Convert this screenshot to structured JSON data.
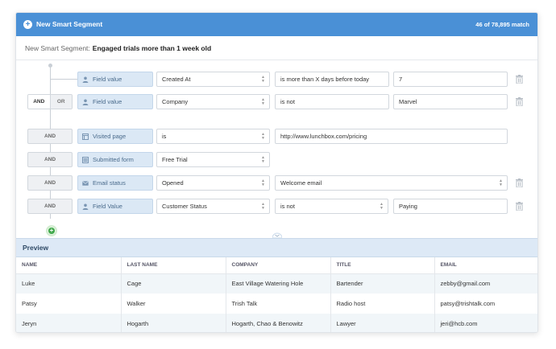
{
  "header": {
    "title": "New Smart Segment",
    "match_count": "46 of 78,895 match"
  },
  "segment": {
    "name_prefix": "New Smart Segment:",
    "name": "Engaged trials more than 1 week old"
  },
  "rules": [
    {
      "conjunction": "",
      "type_icon": "person-icon",
      "type_label": "Field value",
      "field": "Created At",
      "operator": "is more than X days before today",
      "value": "7",
      "has_trash": true
    },
    {
      "conjunction": "AND|OR",
      "conj_and": "AND",
      "conj_or": "OR",
      "type_icon": "person-icon",
      "type_label": "Field value",
      "field": "Company",
      "operator": "is not",
      "value": "Marvel",
      "has_trash": true
    },
    {
      "conjunction": "AND",
      "type_icon": "page-icon",
      "type_label": "Visited page",
      "field": "is",
      "value": "http://www.lunchbox.com/pricing",
      "has_trash": false
    },
    {
      "conjunction": "AND",
      "type_icon": "form-icon",
      "type_label": "Submitted form",
      "field": "Free Trial",
      "has_trash": false
    },
    {
      "conjunction": "AND",
      "type_icon": "envelope-icon",
      "type_label": "Email status",
      "field": "Opened",
      "value": "Welcome email",
      "has_trash": true
    },
    {
      "conjunction": "AND",
      "type_icon": "person-icon",
      "type_label": "Field Value",
      "field": "Customer Status",
      "operator": "is not",
      "value": "Paying",
      "has_trash": true
    }
  ],
  "preview": {
    "title": "Preview",
    "columns": [
      "NAME",
      "LAST NAME",
      "COMPANY",
      "TITLE",
      "EMAIL"
    ],
    "rows": [
      [
        "Luke",
        "Cage",
        "East Village Watering Hole",
        "Bartender",
        "zebby@gmail.com"
      ],
      [
        "Patsy",
        "Walker",
        "Trish Talk",
        "Radio host",
        "patsy@trishtalk.com"
      ],
      [
        "Jeryn",
        "Hogarth",
        "Hogarth, Chao & Benowitz",
        "Lawyer",
        "jeri@hcb.com"
      ]
    ]
  },
  "colors": {
    "header_bg": "#4a90d6",
    "tag_bg": "#dbe8f5",
    "preview_bar_bg": "#dde9f6",
    "add_green": "#3fa84a"
  }
}
